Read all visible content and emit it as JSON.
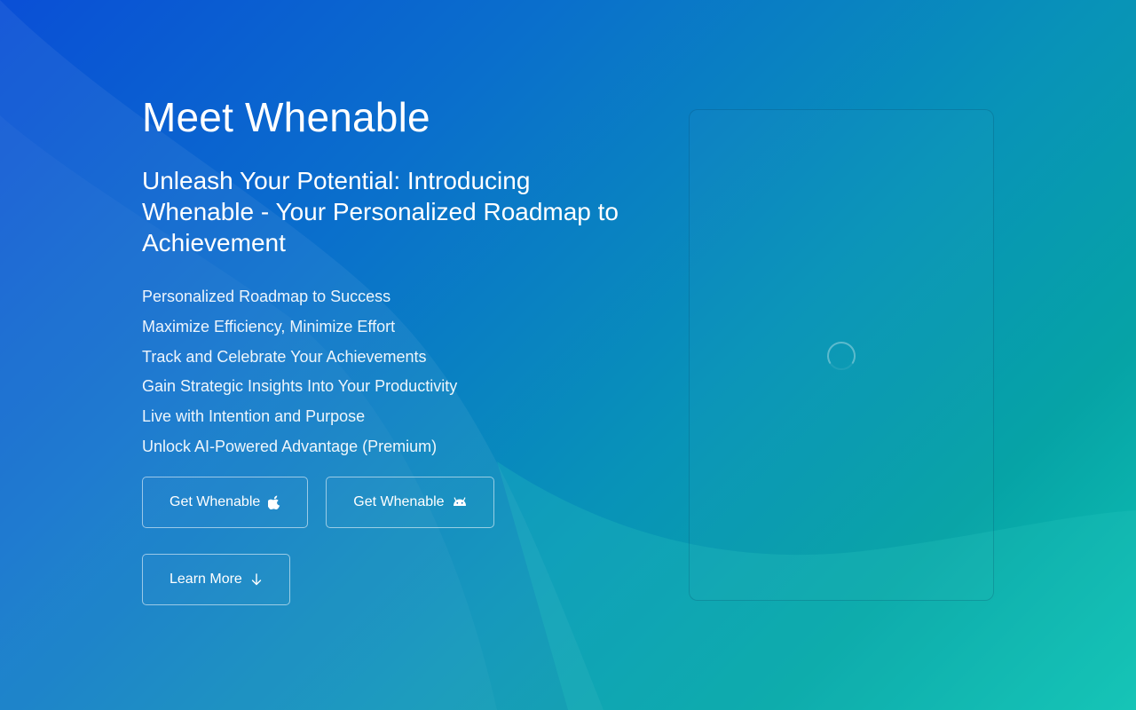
{
  "hero": {
    "title": "Meet Whenable",
    "subtitle": "Unleash Your Potential: Introducing Whenable - Your Personalized Roadmap to Achievement",
    "features": [
      "Personalized Roadmap to Success",
      "Maximize Efficiency, Minimize Effort",
      "Track and Celebrate Your Achievements",
      "Gain Strategic Insights Into Your Productivity",
      "Live with Intention and Purpose",
      "Unlock AI-Powered Advantage (Premium)"
    ]
  },
  "buttons": {
    "ios": {
      "label": "Get Whenable",
      "icon": "apple-icon"
    },
    "android": {
      "label": "Get Whenable",
      "icon": "android-icon"
    },
    "learn_more": {
      "label": "Learn More",
      "icon": "arrow-down-icon"
    }
  },
  "preview": {
    "status_icon": "loading-spinner-icon"
  },
  "colors": {
    "gradient_start": "#0a4fd6",
    "gradient_mid": "#0893b8",
    "gradient_end": "#10c4b4",
    "text": "#ffffff"
  }
}
